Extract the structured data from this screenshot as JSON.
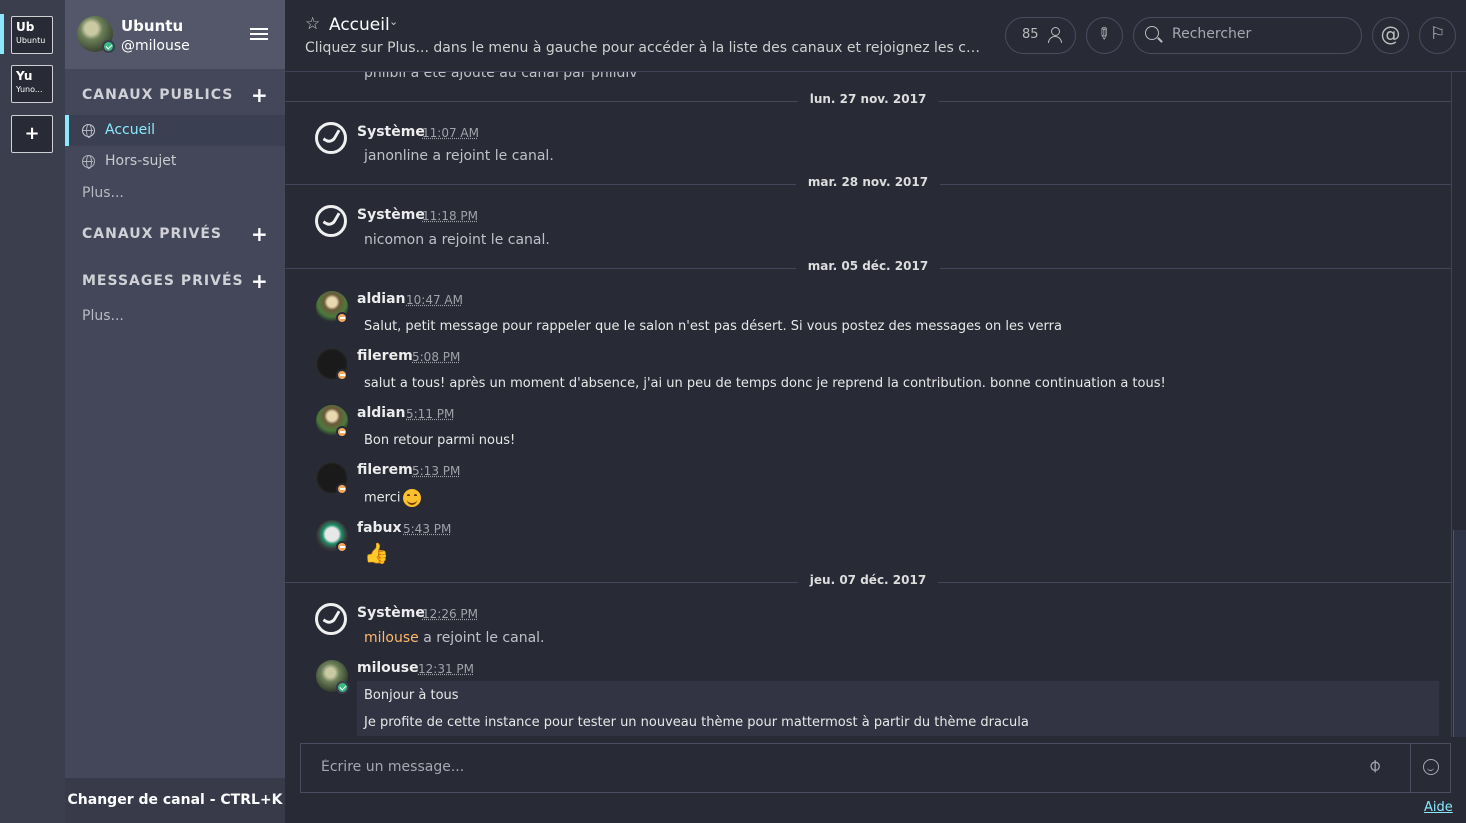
{
  "teams": [
    {
      "initials": "Ub",
      "name": "Ubuntu"
    },
    {
      "initials": "Yu",
      "name": "Yuno..."
    }
  ],
  "team_add_label": "+",
  "sidebar": {
    "team_name": "Ubuntu",
    "username": "@milouse",
    "public_title": "CANAUX PUBLICS",
    "private_title": "CANAUX PRIVÉS",
    "dm_title": "MESSAGES PRIVÉS",
    "add_label": "+",
    "channels": [
      "Accueil",
      "Hors-sujet"
    ],
    "more_public": "Plus...",
    "more_dm": "Plus...",
    "switch_channel": "Changer de canal - CTRL+K"
  },
  "header": {
    "channel_name": "Accueil",
    "purpose": "Cliquez sur Plus... dans le menu à gauche pour accéder à la liste des canaux et rejoignez les canau...",
    "member_count": "85",
    "search_placeholder": "Rechercher",
    "mention_icon": "@",
    "flag_icon": "⚐"
  },
  "posts": {
    "partial_top": "philbil a été ajouté au canal par phildiv",
    "d1": "lun. 27 nov. 2017",
    "d2": "mar. 28 nov. 2017",
    "d3": "mar. 05 déc. 2017",
    "d4": "jeu. 07 déc. 2017",
    "p1": {
      "author": "Système",
      "time": "11:07 AM",
      "text": "janonline a rejoint le canal."
    },
    "p2": {
      "author": "Système",
      "time": "11:18 PM",
      "text": "nicomon a rejoint le canal."
    },
    "p3": {
      "author": "aldian",
      "time": "10:47 AM",
      "text": "Salut, petit message pour rappeler que le salon n'est pas désert. Si vous postez des messages on les verra"
    },
    "p4": {
      "author": "filerem",
      "time": "5:08 PM",
      "text": "salut a tous! après un moment d'absence, j'ai un peu de temps donc je reprend la contribution. bonne continuation a tous!"
    },
    "p5": {
      "author": "aldian",
      "time": "5:11 PM",
      "text": "Bon retour parmi nous!"
    },
    "p6": {
      "author": "filerem",
      "time": "5:13 PM",
      "text": "merci"
    },
    "p7": {
      "author": "fabux",
      "time": "5:43 PM",
      "text": "👍"
    },
    "p8": {
      "author": "Système",
      "time": "12:26 PM",
      "mention": "milouse",
      "text": " a rejoint le canal."
    },
    "p9": {
      "author": "milouse",
      "time": "12:31 PM",
      "line1": "Bonjour à tous",
      "line2": "Je profite de cette instance pour tester un nouveau thème pour mattermost à partir du thème dracula"
    }
  },
  "input": {
    "placeholder": "Écrire un message...",
    "help": "Aide"
  },
  "colors": {
    "background": "#282a36",
    "sidebar": "#44475a",
    "accent": "#8be9fd",
    "mention": "#ffb86c",
    "online": "#3db887",
    "away": "#f5a85c"
  }
}
